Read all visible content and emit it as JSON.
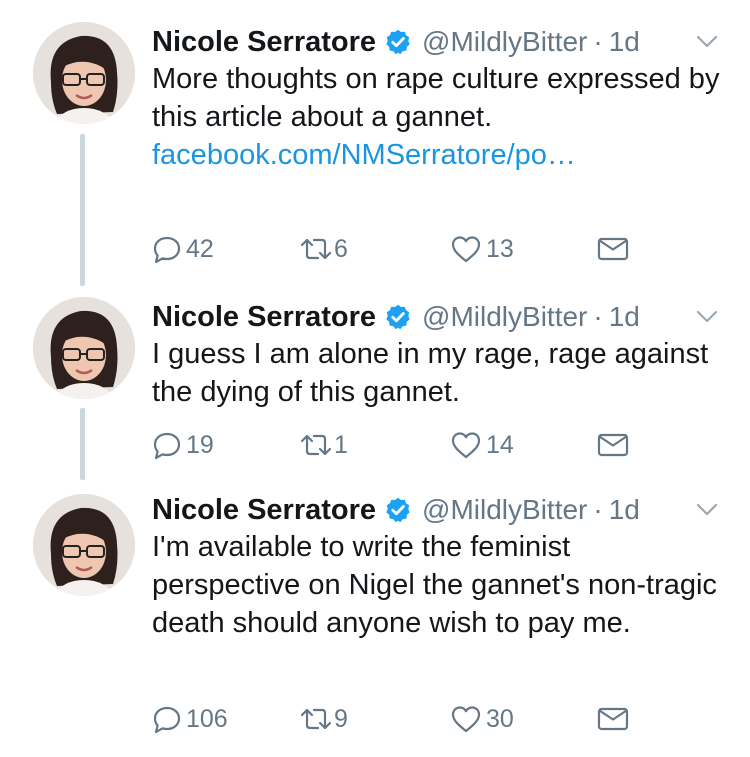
{
  "tweets": [
    {
      "name": "Nicole Serratore",
      "handle": "@MildlyBitter",
      "separator": "·",
      "time": "1d",
      "text": "More thoughts on rape culture expressed by this article about a gannet. ",
      "link": "facebook.com/NMSerratore/po…",
      "replies": "42",
      "retweets": "6",
      "likes": "13"
    },
    {
      "name": "Nicole Serratore",
      "handle": "@MildlyBitter",
      "separator": "·",
      "time": "1d",
      "text": "I guess I am alone in my rage, rage against the dying of this gannet.",
      "replies": "19",
      "retweets": "1",
      "likes": "14"
    },
    {
      "name": "Nicole Serratore",
      "handle": "@MildlyBitter",
      "separator": "·",
      "time": "1d",
      "text": "I'm available to write the feminist perspective on Nigel the gannet's non-tragic death should anyone wish to pay me.",
      "replies": "106",
      "retweets": "9",
      "likes": "30"
    }
  ],
  "icons": {
    "verified": "verified-badge-icon",
    "caret": "chevron-down-icon",
    "reply": "reply-icon",
    "retweet": "retweet-icon",
    "like": "heart-icon",
    "dm": "envelope-icon"
  },
  "colors": {
    "text": "#14171a",
    "secondary": "#657786",
    "link": "#1b95e0",
    "verified": "#1da1f2",
    "thread_line": "#ccd6dd"
  }
}
